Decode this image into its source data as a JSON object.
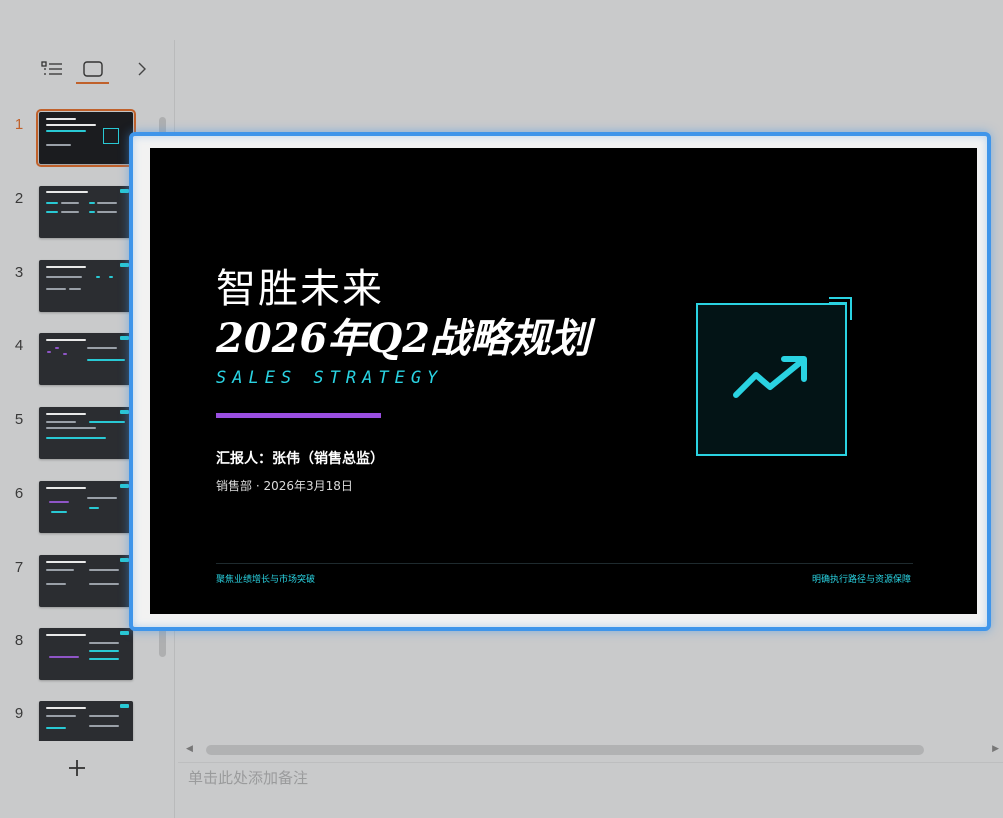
{
  "left_panel": {
    "toolbar": {
      "outline_view": "list-outline-icon",
      "thumbnail_view": "slide-thumbnail-icon",
      "collapse": "chevron-right-icon"
    },
    "thumbnails": [
      {
        "number": "1",
        "active": true
      },
      {
        "number": "2",
        "active": false
      },
      {
        "number": "3",
        "active": false
      },
      {
        "number": "4",
        "active": false
      },
      {
        "number": "5",
        "active": false
      },
      {
        "number": "6",
        "active": false
      },
      {
        "number": "7",
        "active": false
      },
      {
        "number": "8",
        "active": false
      },
      {
        "number": "9",
        "active": false
      }
    ],
    "add_slide": "+"
  },
  "slide": {
    "title_line1": "智胜未来",
    "title_line2": "2026年Q2战略规划",
    "subtitle_en": "SALES STRATEGY",
    "presenter": "汇报人：张伟（销售总监）",
    "dept_date": "销售部 · 2026年3月18日",
    "footer_left": "聚焦业绩增长与市场突破",
    "footer_right": "明确执行路径与资源保障",
    "icon": "trend-up-icon",
    "colors": {
      "background": "#000000",
      "accent_cyan": "#2ad3e2",
      "accent_purple": "#9a4fe0",
      "selection_blue": "#3f95ea"
    }
  },
  "notes": {
    "placeholder": "单击此处添加备注"
  },
  "scrollbar": {
    "left_arrow": "◀",
    "right_arrow": "▶"
  }
}
